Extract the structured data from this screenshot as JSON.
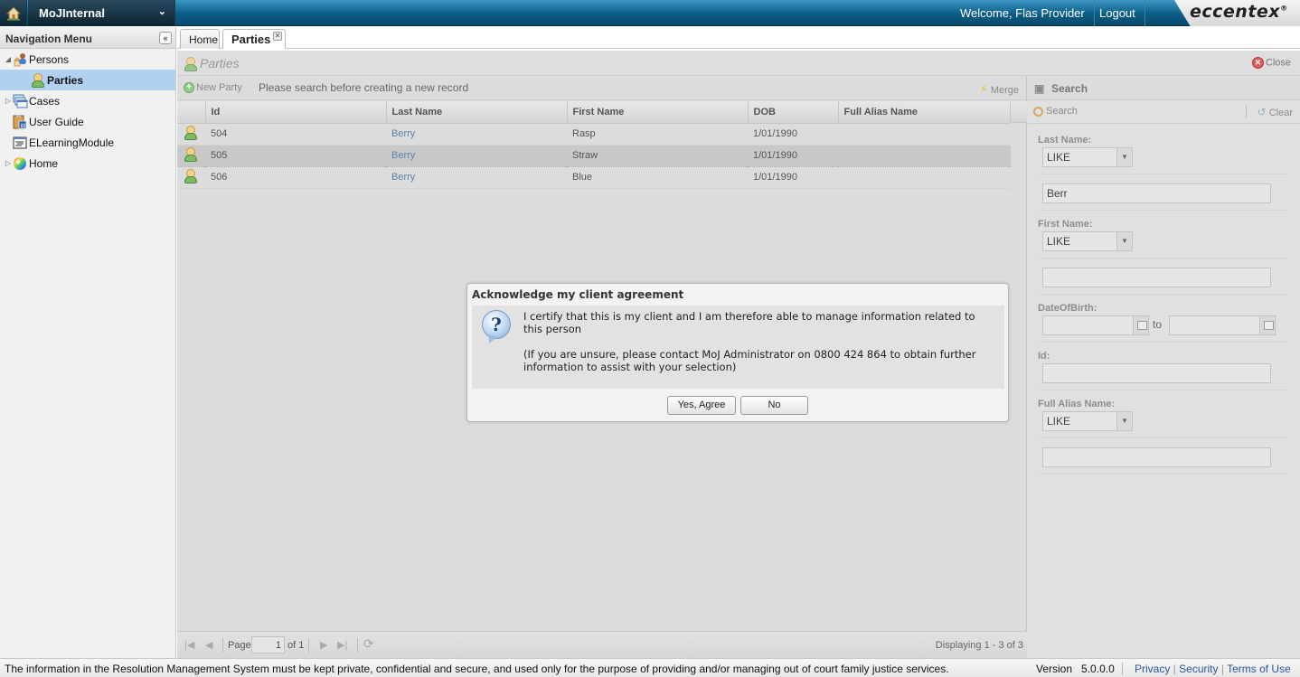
{
  "header": {
    "app_name": "MoJInternal",
    "welcome": "Welcome, Flas Provider",
    "logout": "Logout",
    "brand": "eccentex",
    "brand_mark": "®"
  },
  "sidebar": {
    "title": "Navigation Menu",
    "items": [
      {
        "label": "Persons",
        "icon": "persons-icon",
        "expanded": true
      },
      {
        "label": "Parties",
        "icon": "person-icon",
        "selected": true
      },
      {
        "label": "Cases",
        "icon": "cases-icon",
        "expanded": false
      },
      {
        "label": "User Guide",
        "icon": "user-guide-icon"
      },
      {
        "label": "ELearningModule",
        "icon": "elearning-icon"
      },
      {
        "label": "Home",
        "icon": "home-globe-icon",
        "expanded": false
      }
    ]
  },
  "tabs": [
    {
      "label": "Home"
    },
    {
      "label": "Parties",
      "active": true
    }
  ],
  "panel": {
    "title": "Parties",
    "close": "Close"
  },
  "grid_toolbar": {
    "new_party": "New Party",
    "hint": "Please search before creating a new record",
    "merge": "Merge"
  },
  "grid": {
    "columns": [
      "Id",
      "Last Name",
      "First Name",
      "DOB",
      "Full Alias Name"
    ],
    "rows": [
      {
        "id": "504",
        "last_name": "Berry",
        "first_name": "Rasp",
        "dob": "1/01/1990",
        "alias": ""
      },
      {
        "id": "505",
        "last_name": "Berry",
        "first_name": "Straw",
        "dob": "1/01/1990",
        "alias": "",
        "selected": true
      },
      {
        "id": "506",
        "last_name": "Berry",
        "first_name": "Blue",
        "dob": "1/01/1990",
        "alias": ""
      }
    ]
  },
  "pager": {
    "page_label": "Page",
    "page_value": "1",
    "of_label": "of 1",
    "displaying": "Displaying 1 - 3 of 3"
  },
  "search": {
    "title": "Search",
    "search_btn": "Search",
    "clear_btn": "Clear",
    "last_name_label": "Last Name:",
    "last_name_op": "LIKE",
    "last_name_value": "Berr",
    "first_name_label": "First Name:",
    "first_name_op": "LIKE",
    "first_name_value": "",
    "dob_label": "DateOfBirth:",
    "dob_to": "to",
    "id_label": "Id:",
    "alias_label": "Full Alias Name:",
    "alias_op": "LIKE",
    "alias_value": ""
  },
  "dialog": {
    "title": "Acknowledge my client agreement",
    "message1": "I certify that this is my client and I am therefore able to manage information related to this person",
    "message2": "(If you are unsure, please contact MoJ Administrator on 0800 424 864 to obtain further information to assist with your selection)",
    "yes": "Yes, Agree",
    "no": "No"
  },
  "footer": {
    "notice": "The information in the Resolution Management System must be kept private, confidential and secure, and used only for the purpose of providing and/or managing out of court family justice services.",
    "version_label": "Version",
    "version": "5.0.0.0",
    "privacy": "Privacy",
    "security": "Security",
    "terms": "Terms of Use"
  }
}
